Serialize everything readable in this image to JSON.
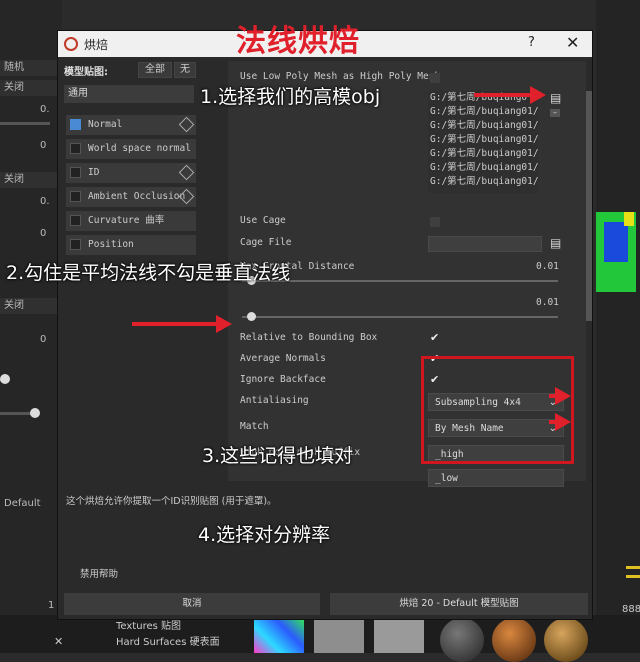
{
  "annotation_title": "法线烘焙",
  "annotations": {
    "step1": "1.选择我们的高模obj",
    "step2": "2.勾住是平均法线不勾是垂直法线",
    "step3": "3.这些记得也填对",
    "step4": "4.选择对分辨率"
  },
  "background": {
    "left_rows": [
      "随机",
      "关闭",
      "关闭",
      "关闭",
      "关闭",
      "关闭"
    ],
    "left_nums": [
      "0.",
      "0",
      "0.",
      "0",
      "0",
      "0"
    ],
    "default_label": "Default",
    "bottom_value": "1",
    "bottom_close": "✕",
    "textures_label": "Textures 贴图",
    "hard_surfaces_label": "Hard Surfaces 硬表面",
    "right_value": "888"
  },
  "dialog": {
    "title": "烘焙",
    "help_label": "?",
    "close_label": "✕",
    "model_maps_label": "模型贴图:",
    "all_button": "全部",
    "none_button": "无",
    "preset": "通用",
    "maps": [
      {
        "label": "Normal",
        "checked": true,
        "icon": "cube-icon"
      },
      {
        "label": "World space normal",
        "checked": false,
        "icon": ""
      },
      {
        "label": "ID",
        "checked": false,
        "icon": "cube-icon"
      },
      {
        "label": "Ambient Occlusion",
        "checked": false,
        "icon": "cube-icon"
      },
      {
        "label": "Curvature 曲率",
        "checked": false,
        "icon": ""
      },
      {
        "label": "Position",
        "checked": false,
        "icon": ""
      }
    ],
    "use_low_as_high_label": "Use Low Poly Mesh as High Poly Mesh",
    "high_poly_paths": [
      "G:/第七周/buqiang0",
      "G:/第七周/buqiang01/q",
      "G:/第七周/buqiang01/q",
      "G:/第七周/buqiang01/q",
      "G:/第七周/buqiang01/q",
      "G:/第七周/buqiang01/q",
      "G:/第七周/buqiang01/q"
    ],
    "use_cage_label": "Use Cage",
    "cage_file_label": "Cage File",
    "max_frontal_label": "Max Frontal Distance",
    "max_frontal_value": "0.01",
    "max_frontal_level": 0.03,
    "max_rear_value": "0.01",
    "max_rear_level": 0.03,
    "relative_bbox_label": "Relative to Bounding Box",
    "average_normals_label": "Average Normals",
    "ignore_backface_label": "Ignore Backface",
    "antialiasing_label": "Antialiasing",
    "antialiasing_value": "Subsampling 4x4",
    "match_label": "Match",
    "match_value": "By Mesh Name",
    "high_suffix_label": "High poly mesh suffix",
    "high_suffix_value": "_high",
    "low_suffix_value": "_low",
    "info_text": "这个烘焙允许你提取一个ID识别贴图 (用于遮罩)。",
    "disable_help": "禁用帮助",
    "cancel_button": "取消",
    "bake_button": "烘焙 20 - Default 模型贴图"
  },
  "colors": {
    "annotation_red": "#e0202a",
    "checkbox_blue": "#4a8ad4"
  }
}
